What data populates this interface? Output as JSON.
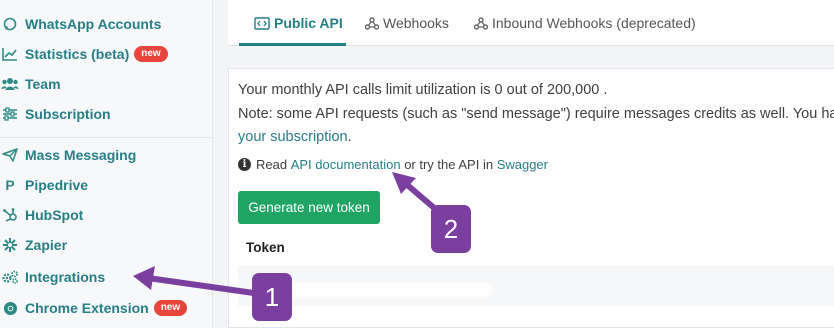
{
  "sidebar": {
    "items": [
      {
        "label": "WhatsApp Accounts",
        "icon": "whatsapp-icon"
      },
      {
        "label": "Statistics (beta)",
        "icon": "chart-line-icon",
        "badge": "new"
      },
      {
        "label": "Team",
        "icon": "users-icon"
      },
      {
        "label": "Subscription",
        "icon": "sliders-icon"
      },
      {
        "label": "Mass Messaging",
        "icon": "paper-plane-icon"
      },
      {
        "label": "Pipedrive",
        "icon": "pipedrive-icon"
      },
      {
        "label": "HubSpot",
        "icon": "hubspot-icon"
      },
      {
        "label": "Zapier",
        "icon": "zapier-icon"
      },
      {
        "label": "Integrations",
        "icon": "gears-icon"
      },
      {
        "label": "Chrome Extension",
        "icon": "chrome-icon",
        "badge": "new"
      }
    ]
  },
  "tabs": [
    {
      "label": "Public API",
      "icon": "code-icon",
      "active": true
    },
    {
      "label": "Webhooks",
      "icon": "webhook-icon",
      "active": false
    },
    {
      "label": "Inbound Webhooks (deprecated)",
      "icon": "webhook-icon",
      "active": false
    }
  ],
  "api": {
    "limit_text": "Your monthly API calls limit utilization is 0 out of 200,000 .",
    "note_text": "Note: some API requests (such as \"send message\") require messages credits as well. You ha",
    "subscription_link": "your subscription",
    "subscription_suffix": ".",
    "read_prefix": "Read",
    "docs_link": "API documentation",
    "or_text": "or try the API in",
    "swagger_link": "Swagger",
    "generate_button": "Generate new token",
    "token_header": "Token"
  },
  "annotations": [
    {
      "number": "1",
      "points_to": "Integrations"
    },
    {
      "number": "2",
      "points_to": "API documentation"
    }
  ],
  "colors": {
    "accent": "#267f86",
    "badge": "#e8453c",
    "button": "#1fa463",
    "annotation": "#7b3fa0"
  }
}
